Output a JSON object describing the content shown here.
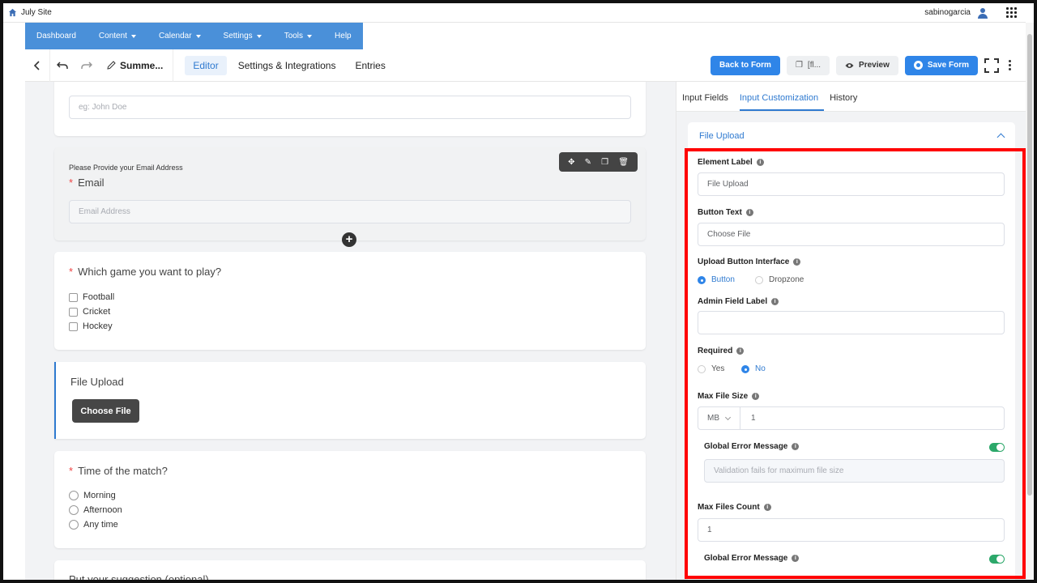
{
  "topbar": {
    "site_name": "July Site",
    "username": "sabinogarcia"
  },
  "nav": {
    "items": [
      {
        "label": "Dashboard"
      },
      {
        "label": "Content"
      },
      {
        "label": "Calendar"
      },
      {
        "label": "Settings"
      },
      {
        "label": "Tools"
      },
      {
        "label": "Help"
      }
    ]
  },
  "toolbar": {
    "form_title": "Summe...",
    "tabs": [
      {
        "label": "Editor"
      },
      {
        "label": "Settings & Integrations"
      },
      {
        "label": "Entries"
      }
    ],
    "back_to_form": "Back to Form",
    "shortcode": "[fl...",
    "preview": "Preview",
    "save_form": "Save Form"
  },
  "form": {
    "name_field": {
      "placeholder": "eg: John Doe"
    },
    "email_field": {
      "help": "Please Provide your Email Address",
      "label": "Email",
      "placeholder": "Email Address"
    },
    "game_field": {
      "label": "Which game you want to play?",
      "options": [
        "Football",
        "Cricket",
        "Hockey"
      ]
    },
    "upload_field": {
      "label": "File Upload",
      "button": "Choose File"
    },
    "time_field": {
      "label": "Time of the match?",
      "options": [
        "Morning",
        "Afternoon",
        "Any time"
      ]
    },
    "suggestion_field": {
      "label": "Put your suggestion (optional)"
    }
  },
  "panel": {
    "tabs": [
      {
        "label": "Input Fields"
      },
      {
        "label": "Input Customization"
      },
      {
        "label": "History"
      }
    ],
    "section_title": "File Upload",
    "element_label": {
      "label": "Element Label",
      "value": "File Upload"
    },
    "button_text": {
      "label": "Button Text",
      "value": "Choose File"
    },
    "upload_interface": {
      "label": "Upload Button Interface",
      "options": [
        "Button",
        "Dropzone"
      ],
      "selected": "Button"
    },
    "admin_label": {
      "label": "Admin Field Label",
      "value": ""
    },
    "required": {
      "label": "Required",
      "options": [
        "Yes",
        "No"
      ],
      "selected": "No"
    },
    "max_file_size": {
      "label": "Max File Size",
      "unit": "MB",
      "value": "1"
    },
    "global_error_1": {
      "label": "Global Error Message",
      "enabled": true,
      "placeholder": "Validation fails for maximum file size"
    },
    "max_files_count": {
      "label": "Max Files Count",
      "value": "1"
    },
    "global_error_2": {
      "label": "Global Error Message",
      "enabled": true
    }
  },
  "colors": {
    "nav_bg": "#4a90d9",
    "primary": "#2f85e8",
    "highlight_border": "#ff0000",
    "toggle_on": "#2ca86a"
  }
}
